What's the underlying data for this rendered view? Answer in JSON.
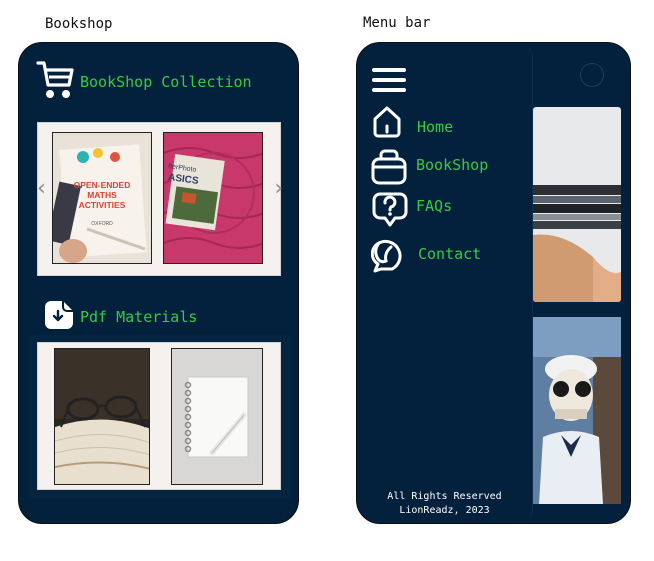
{
  "captions": {
    "left": "Bookshop",
    "right": "Menu bar"
  },
  "bookshop": {
    "collection_title": "BookShop Collection",
    "pdf_title": "Pdf Materials",
    "book_cover": {
      "title_line1": "OPEN-ENDED",
      "title_line2": "MATHS",
      "title_line3": "ACTIVITIES",
      "publisher": "OXFORD"
    },
    "second_book": {
      "title_line1": "fterPhoto",
      "title_line2": "ASICS"
    },
    "prev_arrow": "‹",
    "next_arrow": "›"
  },
  "menu": {
    "items": [
      {
        "label": "Home",
        "icon": "home-icon"
      },
      {
        "label": "BookShop",
        "icon": "bag-icon"
      },
      {
        "label": "FAQs",
        "icon": "question-bubble-icon"
      },
      {
        "label": "Contact",
        "icon": "contact-icon"
      }
    ],
    "footer_line1": "All Rights Reserved",
    "footer_line2": "LionReadz, 2023"
  },
  "colors": {
    "background": "#03203c",
    "accent": "#33cc44",
    "icon": "#ffffff"
  }
}
